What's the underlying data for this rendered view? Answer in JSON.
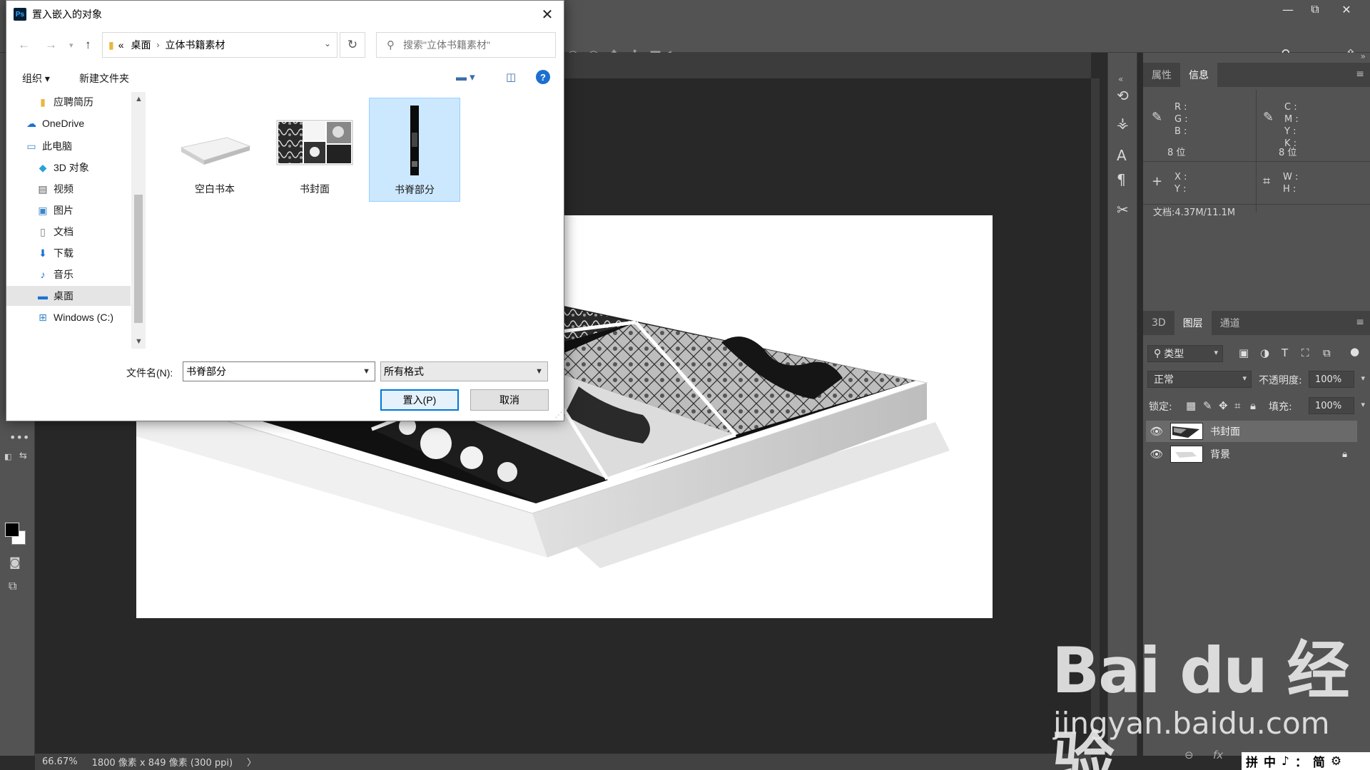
{
  "window": {
    "minimize": "—",
    "restore": "⧉",
    "close": "✕"
  },
  "statusbar": {
    "zoom": "66.67%",
    "doc_size": "1800 像素 x 849 像素 (300 ppi)",
    "arrow": "〉"
  },
  "panels": {
    "info": {
      "tabs": [
        "属性",
        "信息"
      ],
      "rgb_labels": [
        "R :",
        "G :",
        "B :"
      ],
      "cmyk_labels": [
        "C :",
        "M :",
        "Y :",
        "K :"
      ],
      "bits_left": "8 位",
      "bits_right": "8 位",
      "xy_labels": [
        "X :",
        "Y :"
      ],
      "wh_labels": [
        "W :",
        "H :"
      ],
      "doc_info": "文档:4.37M/11.1M"
    },
    "layers": {
      "tabs": [
        "3D",
        "图层",
        "通道"
      ],
      "filter_kind": "类型",
      "blend_mode": "正常",
      "opacity_label": "不透明度:",
      "opacity_value": "100%",
      "lock_label": "锁定:",
      "fill_label": "填充:",
      "fill_value": "100%",
      "items": [
        {
          "name": "书封面",
          "selected": true,
          "locked": false
        },
        {
          "name": "背景",
          "selected": false,
          "locked": true
        }
      ]
    }
  },
  "watermark": {
    "logo": "Bai du 经验",
    "url": "jingyan.baidu.com"
  },
  "ime": {
    "items": [
      "拼",
      "中",
      "♪",
      "：",
      "简",
      "⚙"
    ]
  },
  "dialog": {
    "title": "置入嵌入的对象",
    "breadcrumb": [
      "«",
      "桌面",
      "立体书籍素材"
    ],
    "search_placeholder": "搜索\"立体书籍素材\"",
    "organize": "组织 ▾",
    "new_folder": "新建文件夹",
    "help": "?",
    "nav_items": [
      {
        "label": "应聘简历",
        "icon": "folder-icon",
        "indent": 1,
        "selected": false
      },
      {
        "label": "OneDrive",
        "icon": "cloud-icon",
        "indent": 0,
        "selected": false
      },
      {
        "label": "此电脑",
        "icon": "computer-icon",
        "indent": 0,
        "selected": false
      },
      {
        "label": "3D 对象",
        "icon": "cube-icon",
        "indent": 1,
        "selected": false
      },
      {
        "label": "视频",
        "icon": "film-icon",
        "indent": 1,
        "selected": false
      },
      {
        "label": "图片",
        "icon": "picture-icon",
        "indent": 1,
        "selected": false
      },
      {
        "label": "文档",
        "icon": "document-icon",
        "indent": 1,
        "selected": false
      },
      {
        "label": "下载",
        "icon": "download-icon",
        "indent": 1,
        "selected": false
      },
      {
        "label": "音乐",
        "icon": "music-icon",
        "indent": 1,
        "selected": false
      },
      {
        "label": "桌面",
        "icon": "desktop-icon",
        "indent": 1,
        "selected": true
      },
      {
        "label": "Windows (C:)",
        "icon": "drive-icon",
        "indent": 1,
        "selected": false
      }
    ],
    "files": [
      {
        "name": "空白书本",
        "selected": false
      },
      {
        "name": "书封面",
        "selected": false
      },
      {
        "name": "书脊部分",
        "selected": true
      }
    ],
    "filename_label": "文件名(N):",
    "filename_value": "书脊部分",
    "filetype_value": "所有格式",
    "place_button": "置入(P)",
    "cancel_button": "取消"
  },
  "colors": {
    "ps_panel": "#535353",
    "ps_canvas": "#282828",
    "selection": "#cce8ff",
    "accent": "#0078d7"
  }
}
